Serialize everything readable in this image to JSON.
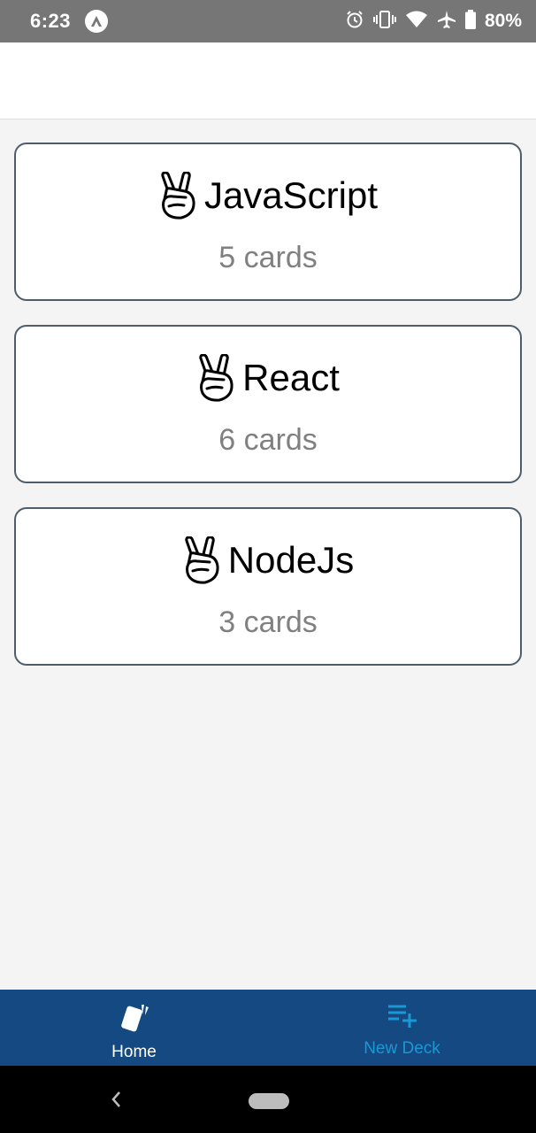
{
  "status_bar": {
    "time": "6:23",
    "battery": "80%",
    "icons": [
      "app-notification-icon",
      "alarm-icon",
      "vibrate-icon",
      "wifi-icon",
      "airplane-icon",
      "battery-icon"
    ]
  },
  "decks": [
    {
      "icon": "victory-hand-icon",
      "title": "JavaScript",
      "count": "5 cards"
    },
    {
      "icon": "victory-hand-icon",
      "title": "React",
      "count": "6 cards"
    },
    {
      "icon": "victory-hand-icon",
      "title": "NodeJs",
      "count": "3 cards"
    }
  ],
  "tabs": {
    "home": {
      "label": "Home",
      "icon": "cards-icon",
      "active": true
    },
    "new_deck": {
      "label": "New Deck",
      "icon": "playlist-add-icon",
      "active": false
    }
  },
  "colors": {
    "tab_bar": "#144a81",
    "tab_active": "#ffffff",
    "tab_inactive": "#1b97d3",
    "card_border": "#4e5d6c",
    "background": "#f4f4f5"
  }
}
